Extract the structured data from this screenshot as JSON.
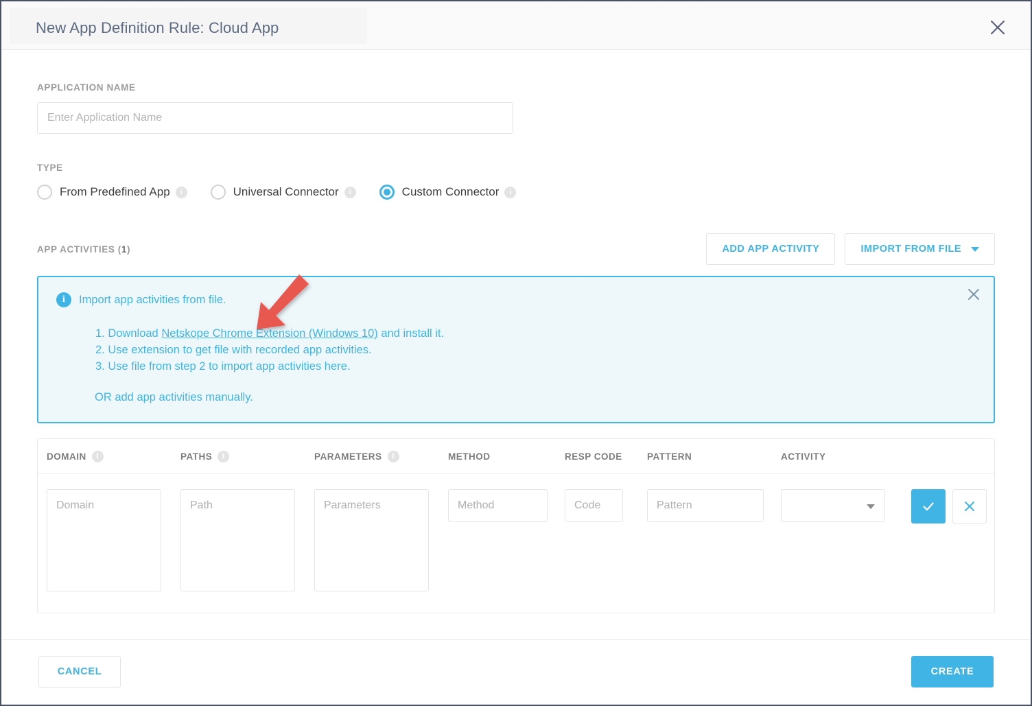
{
  "dialog": {
    "title": "New App Definition Rule: Cloud App",
    "close_icon": "close-icon"
  },
  "form": {
    "app_name_label": "APPLICATION NAME",
    "app_name_value": "",
    "app_name_placeholder": "Enter Application Name",
    "type_label": "TYPE",
    "type_options": [
      {
        "label": "From Predefined App",
        "selected": false,
        "info": "i"
      },
      {
        "label": "Universal Connector",
        "selected": false,
        "info": "i"
      },
      {
        "label": "Custom Connector",
        "selected": true,
        "info": "i"
      }
    ]
  },
  "activities": {
    "title_prefix": "APP ACTIVITIES (",
    "count": "1",
    "title_suffix": ")",
    "add_label": "ADD APP ACTIVITY",
    "import_label": "IMPORT FROM FILE"
  },
  "banner": {
    "icon": "i",
    "heading": "Import app activities from file.",
    "step1_prefix": "1. Download ",
    "step1_link": "Netskope Chrome Extension (Windows 10)",
    "step1_suffix": " and install it.",
    "step2": "2. Use extension to get file with recorded app activities.",
    "step3": "3. Use file from step 2 to import app activities here.",
    "or_text": "OR add app activities manually.",
    "close_icon": "close-icon",
    "accent_color": "#3fb4e5",
    "background_color": "#eef8fb"
  },
  "table": {
    "headers": [
      {
        "label": "DOMAIN",
        "info": "i"
      },
      {
        "label": "PATHS",
        "info": "i"
      },
      {
        "label": "PARAMETERS",
        "info": "i"
      },
      {
        "label": "METHOD",
        "info": ""
      },
      {
        "label": "RESP CODE",
        "info": ""
      },
      {
        "label": "PATTERN",
        "info": ""
      },
      {
        "label": "ACTIVITY",
        "info": ""
      }
    ],
    "row": {
      "domain_value": "",
      "domain_placeholder": "Domain",
      "path_value": "",
      "path_placeholder": "Path",
      "parameters_value": "",
      "parameters_placeholder": "Parameters",
      "method_value": "",
      "method_placeholder": "Method",
      "code_value": "",
      "code_placeholder": "Code",
      "pattern_value": "",
      "pattern_placeholder": "Pattern",
      "activity_value": "",
      "confirm_icon": "check-icon",
      "discard_icon": "close-icon"
    }
  },
  "footer": {
    "cancel_label": "CANCEL",
    "create_label": "CREATE"
  },
  "annotation": {
    "arrow_color": "#e8584f",
    "type": "arrow-pointing-down-left"
  }
}
